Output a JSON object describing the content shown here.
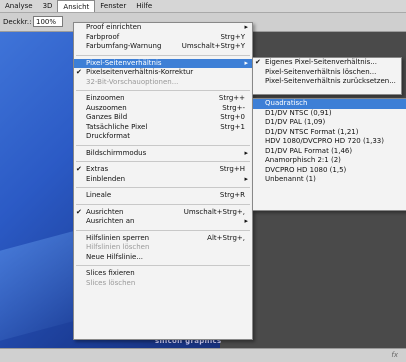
{
  "menubar": {
    "items": [
      "Analyse",
      "3D",
      "Ansicht",
      "Fenster",
      "Hilfe"
    ]
  },
  "options": {
    "label": "Deckkr.:",
    "value": "100%"
  },
  "main_menu": {
    "groups": [
      [
        {
          "label": "Proof einrichten",
          "arrow": true
        },
        {
          "label": "Farbproof",
          "shortcut": "Strg+Y"
        },
        {
          "label": "Farbumfang-Warnung",
          "shortcut": "Umschalt+Strg+Y"
        }
      ],
      [
        {
          "label": "Pixel-Seitenverhältnis",
          "arrow": true,
          "highlight": true
        },
        {
          "label": "Pixelseitenverhältnis-Korrektur",
          "checked": true
        },
        {
          "label": "32-Bit-Vorschauoptionen...",
          "disabled": true
        }
      ],
      [
        {
          "label": "Einzoomen",
          "shortcut": "Strg++"
        },
        {
          "label": "Auszoomen",
          "shortcut": "Strg+-"
        },
        {
          "label": "Ganzes Bild",
          "shortcut": "Strg+0"
        },
        {
          "label": "Tatsächliche Pixel",
          "shortcut": "Strg+1"
        },
        {
          "label": "Druckformat"
        }
      ],
      [
        {
          "label": "Bildschirmmodus",
          "arrow": true
        }
      ],
      [
        {
          "label": "Extras",
          "shortcut": "Strg+H",
          "checked": true
        },
        {
          "label": "Einblenden",
          "arrow": true
        }
      ],
      [
        {
          "label": "Lineale",
          "shortcut": "Strg+R"
        }
      ],
      [
        {
          "label": "Ausrichten",
          "shortcut": "Umschalt+Strg+,",
          "checked": true
        },
        {
          "label": "Ausrichten an",
          "arrow": true
        }
      ],
      [
        {
          "label": "Hilfslinien sperren",
          "shortcut": "Alt+Strg+,"
        },
        {
          "label": "Hilfslinien löschen",
          "disabled": true
        },
        {
          "label": "Neue Hilfslinie..."
        }
      ],
      [
        {
          "label": "Slices fixieren"
        },
        {
          "label": "Slices löschen",
          "disabled": true
        }
      ]
    ]
  },
  "submenu1": [
    {
      "label": "Eigenes Pixel-Seitenverhältnis...",
      "checked": true
    },
    {
      "label": "Pixel-Seitenverhältnis löschen..."
    },
    {
      "label": "Pixel-Seitenverhältnis zurücksetzen..."
    }
  ],
  "submenu2": [
    {
      "label": "Quadratisch",
      "highlight": true
    },
    {
      "label": "D1/DV NTSC (0,91)"
    },
    {
      "label": "D1/DV PAL (1,09)"
    },
    {
      "label": "D1/DV NTSC Format (1,21)"
    },
    {
      "label": "HDV 1080/DVCPRO HD 720 (1,33)"
    },
    {
      "label": "D1/DV PAL Format (1,46)"
    },
    {
      "label": "Anamorphisch 2:1 (2)"
    },
    {
      "label": "DVCPRO HD 1080 (1,5)"
    },
    {
      "label": "Unbenannt (1)"
    }
  ],
  "canvas_brand": "silicon graphics",
  "status_fx": "fx",
  "colors": {
    "highlight": "#3d7fd6",
    "menu_bg": "#f3f3f3",
    "menubar_bg": "#d6d6d6"
  }
}
